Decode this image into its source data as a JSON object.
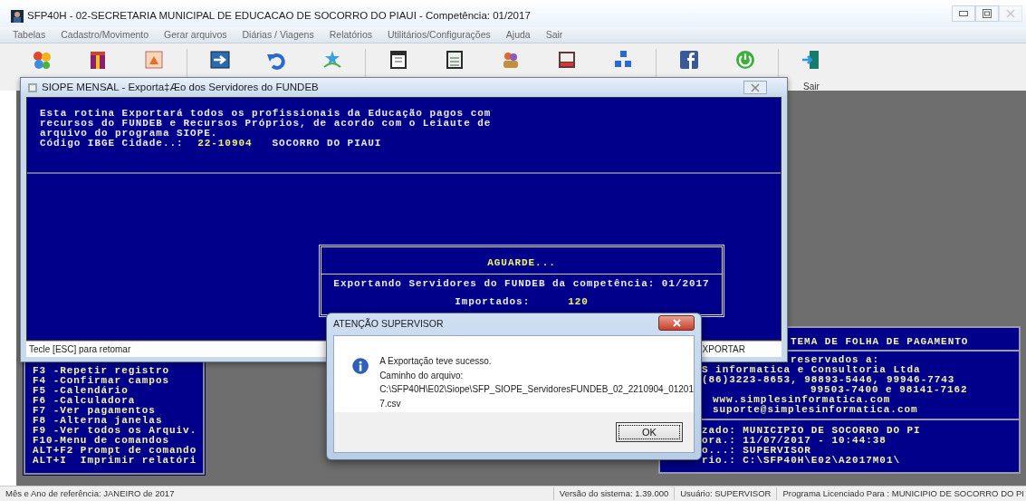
{
  "window": {
    "title": "SFP40H - 02-SECRETARIA MUNICIPAL DE EDUCACAO DE SOCORRO DO PIAUI  -  Competência: 01/2017"
  },
  "menu": [
    "Tabelas",
    "Cadastro/Movimento",
    "Gerar arquivos",
    "Diárias / Viagens",
    "Relatórios",
    "Utilitários/Configurações",
    "Ajuda",
    "Sair"
  ],
  "toolbar": {
    "exit_label": "Sair"
  },
  "export_window": {
    "title": "SIOPE MENSAL - Exporta‡Æo dos Servidores do FUNDEB",
    "intro": [
      "Esta rotina Exportará todos os profissionais da Educação pagos com",
      "recursos do FUNDEB e Recursos Próprios, de acordo com o Leiaute de",
      "arquivo do programa SIOPE."
    ],
    "ibge_label": "Código IBGE Cidade..:",
    "ibge_code": "22-10904",
    "city": "SOCORRO DO PIAUI",
    "hint": "Tecle [ESC] para retomar",
    "action": "XPORTAR"
  },
  "progress": {
    "title": "AGUARDE...",
    "message": "Exportando Servidores do FUNDEB da competência: 01/2017",
    "imported_label": "Importados:",
    "imported_count": "120"
  },
  "dialog": {
    "title": "ATENÇÃO SUPERVISOR",
    "lines": [
      "A Exportação teve sucesso.",
      "Caminho do arquivo:",
      "C:\\SFP40H\\E02\\Siope\\SFP_SIOPE_ServidoresFUNDEB_02_2210904_01201",
      "7.csv"
    ],
    "ok": "OK"
  },
  "shortcuts": [
    "F3 -Repetir registro",
    "F4 -Confirmar campos",
    "F5 -Calendário",
    "F6 -Calculadora",
    "F7 -Ver pagamentos",
    "F8 -Alterna janelas",
    "F9 -Ver todos os Arquiv.",
    "F10-Menu de comandos",
    "ALT+F2 Prompt de comando",
    "ALT+I  Imprimir relatóri"
  ],
  "info_panel": {
    "header": "TEMA DE FOLHA DE PAGAMENTO",
    "company_lines": [
      "reservados a:",
      "S informatica e Consultoria Ltda",
      "(86)3223-8653, 98893-5446, 99946-7743",
      "99503-7400 e 98141-7162",
      "www.simplesinformatica.com",
      "suporte@simplesinformatica.com"
    ],
    "session_lines": [
      "zado: MUNICIPIO DE SOCORRO DO PI",
      "ora.: 11/07/2017 - 10:44:38",
      "o...: SUPERVISOR",
      "rio.: C:\\SFP40H\\E02\\A2017M01\\"
    ]
  },
  "status_bar": [
    "Mês e Ano de referência: JANEIRO de 2017",
    "Versão do sistema: 1.39.000",
    "Usuário: SUPERVISOR",
    "Programa Licenciado Para : MUNICIPIO DE SOCORRO DO PI"
  ]
}
